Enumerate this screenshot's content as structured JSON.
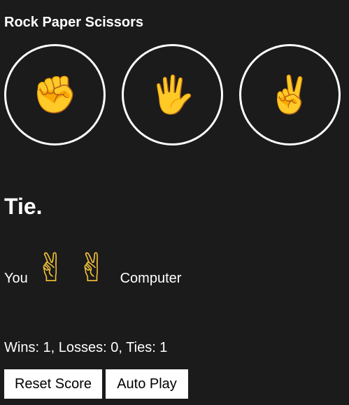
{
  "app": {
    "title": "Rock Paper Scissors"
  },
  "moves": [
    {
      "name": "rock",
      "icon": "✊"
    },
    {
      "name": "paper",
      "icon": "🖐"
    },
    {
      "name": "scissors",
      "icon": "✌"
    }
  ],
  "result": {
    "text": "Tie."
  },
  "last_round": {
    "you_label": "You",
    "you_icon": "✌",
    "computer_icon": "✌",
    "computer_label": "Computer"
  },
  "score": {
    "text": "Wins: 1, Losses: 0, Ties: 1"
  },
  "buttons": {
    "reset_label": "Reset Score",
    "auto_label": "Auto Play"
  },
  "colors": {
    "background": "#1b1b1b",
    "text": "#ffffff",
    "hand": "#f2c037"
  }
}
